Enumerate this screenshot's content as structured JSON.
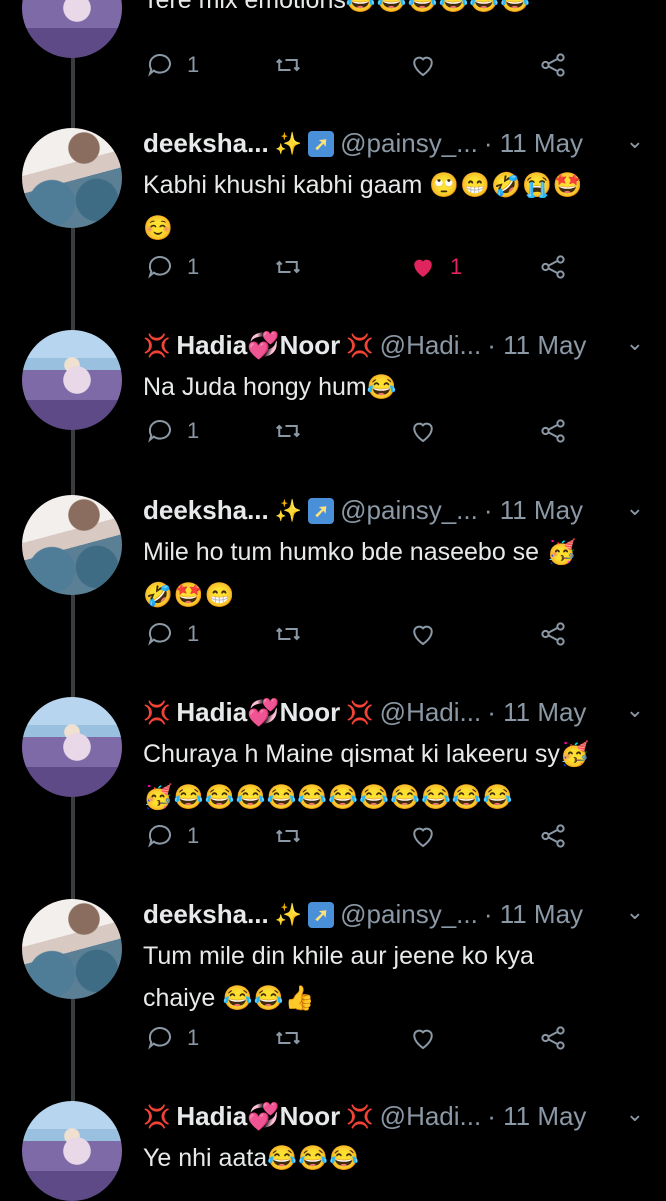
{
  "top_partial": {
    "text": "Tere mix emotions",
    "emojis": "😂😂😂😂😂😂",
    "reply_count": "1"
  },
  "tweets": [
    {
      "name": "deeksha...",
      "deco": "✨",
      "handle": "@painsy_...",
      "date": "· 11 May",
      "text": "Kabhi khushi kabhi gaam",
      "emojis": "🙄😁🤣😭🤩\n☺️",
      "reply_count": "1",
      "like_count": "1",
      "liked": true
    },
    {
      "name": "Hadia",
      "name2": "Noor",
      "deco": "💢",
      "heart": "💞",
      "handle": "@Hadi...",
      "date": "· 11 May",
      "text": "Na Juda hongy hum",
      "emojis": "😂",
      "reply_count": "1"
    },
    {
      "name": "deeksha...",
      "deco": "✨",
      "handle": "@painsy_...",
      "date": "· 11 May",
      "text": "Mile ho tum humko bde naseebo se",
      "emojis": " 🥳\n🤣🤩😁",
      "reply_count": "1"
    },
    {
      "name": "Hadia",
      "name2": "Noor",
      "deco": "💢",
      "heart": "💞",
      "handle": "@Hadi...",
      "date": "· 11 May",
      "text": "Churaya h Maine qismat ki lakeeru sy",
      "emojis": "🥳\n🥳😂😂😂😂😂😂😂😂😂😂😂",
      "reply_count": "1"
    },
    {
      "name": "deeksha...",
      "deco": "✨",
      "handle": "@painsy_...",
      "date": "· 11 May",
      "text": "Tum mile din khile aur jeene ko kya\nchaiye",
      "emojis": " 😂😂👍",
      "reply_count": "1"
    },
    {
      "name": "Hadia",
      "name2": "Noor",
      "deco": "💢",
      "heart": "💞",
      "handle": "@Hadi...",
      "date": "· 11 May",
      "text": "Ye nhi aata",
      "emojis": "😂😂😂"
    }
  ],
  "icons": {
    "reply": "reply-icon",
    "retweet": "retweet-icon",
    "like": "heart-icon",
    "share": "share-icon",
    "verify": "rocket-icon",
    "chevron": "chevron-down-icon"
  },
  "colors": {
    "background": "#000000",
    "like_active": "#e0245e",
    "muted": "#8b98a5"
  }
}
